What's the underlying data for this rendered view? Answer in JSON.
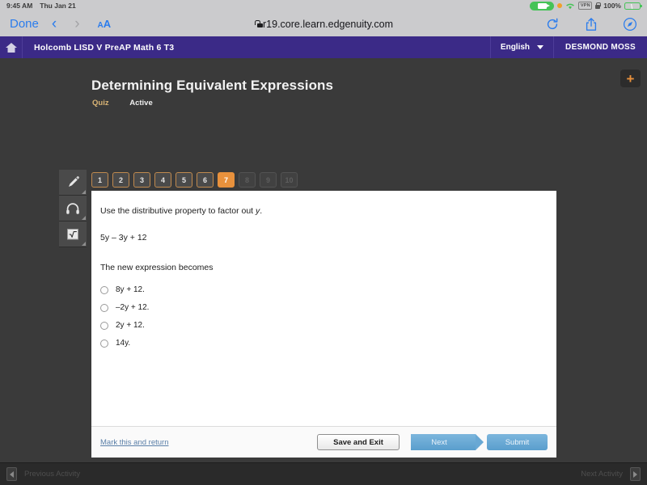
{
  "status_bar": {
    "time": "9:45 AM",
    "date": "Thu Jan 21",
    "battery_percent": "100%",
    "vpn_label": "VPN",
    "icons": [
      "screen-recording-icon",
      "orange-privacy-dot-icon",
      "wifi-icon",
      "vpn-icon",
      "lock-icon",
      "battery-charging-icon"
    ]
  },
  "browser": {
    "done_label": "Done",
    "back_label": "‹",
    "forward_label": "›",
    "text_size_label": "AA",
    "url": "r19.core.learn.edgenuity.com",
    "icons": [
      "reload-icon",
      "share-icon",
      "safari-compass-icon"
    ]
  },
  "appbar": {
    "course_title": "Holcomb LISD V PreAP Math 6 T3",
    "language": "English",
    "user_name": "DESMOND MOSS",
    "accent_color": "#3b2a87"
  },
  "lesson": {
    "title": "Determining Equivalent Expressions",
    "type_label": "Quiz",
    "status_label": "Active",
    "type_color": "#d9b475"
  },
  "tools": [
    {
      "name": "highlighter-tool",
      "icon": "pencil-icon"
    },
    {
      "name": "audio-tool",
      "icon": "headphones-icon"
    },
    {
      "name": "calculator-tool",
      "icon": "square-root-icon"
    }
  ],
  "question_tabs": {
    "active_index": 7,
    "accent_color": "#e8913c",
    "items": [
      {
        "label": "1",
        "state": "available"
      },
      {
        "label": "2",
        "state": "available"
      },
      {
        "label": "3",
        "state": "available"
      },
      {
        "label": "4",
        "state": "available"
      },
      {
        "label": "5",
        "state": "available"
      },
      {
        "label": "6",
        "state": "available"
      },
      {
        "label": "7",
        "state": "active"
      },
      {
        "label": "8",
        "state": "disabled"
      },
      {
        "label": "9",
        "state": "disabled"
      },
      {
        "label": "10",
        "state": "disabled"
      }
    ]
  },
  "question": {
    "prompt_before": "Use the distributive property to factor out ",
    "prompt_var": "y",
    "prompt_after": ".",
    "expression": "5y – 3y + 12",
    "sub_prompt": "The new expression becomes",
    "options": [
      {
        "label": "8y + 12.",
        "selected": false
      },
      {
        "label": "–2y + 12.",
        "selected": false
      },
      {
        "label": "2y + 12.",
        "selected": false
      },
      {
        "label": "14y.",
        "selected": false
      }
    ]
  },
  "footer": {
    "mark_link": "Mark this and return",
    "save_exit_label": "Save and Exit",
    "next_label": "Next",
    "submit_label": "Submit"
  },
  "activity_bar": {
    "previous_label": "Previous Activity",
    "next_label": "Next Activity"
  },
  "add_tab": {
    "glyph": "+",
    "color": "#e8913c"
  }
}
